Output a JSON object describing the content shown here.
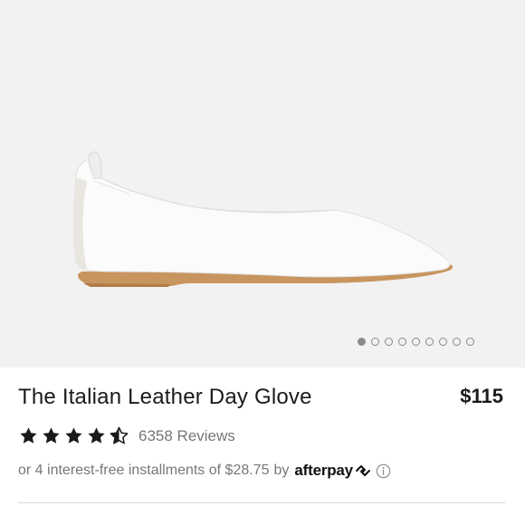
{
  "product": {
    "title": "The Italian Leather Day Glove",
    "price": "$115",
    "rating": 4.5,
    "rating_max": 5,
    "reviews_label": "6358 Reviews"
  },
  "gallery": {
    "image_count": 9,
    "active_index": 0
  },
  "payment": {
    "installments_text": "or 4 interest-free installments of $28.75",
    "by_label": "by",
    "provider_name": "afterpay"
  },
  "icons": {
    "star": "star-icon",
    "star_half": "star-half-icon",
    "afterpay": "afterpay-arrows-icon",
    "info": "info-icon"
  },
  "colors": {
    "hero_background": "#f2f2f2",
    "text_primary": "#1a1a1a",
    "text_secondary": "#777777",
    "shoe_sole": "#c8955f"
  }
}
